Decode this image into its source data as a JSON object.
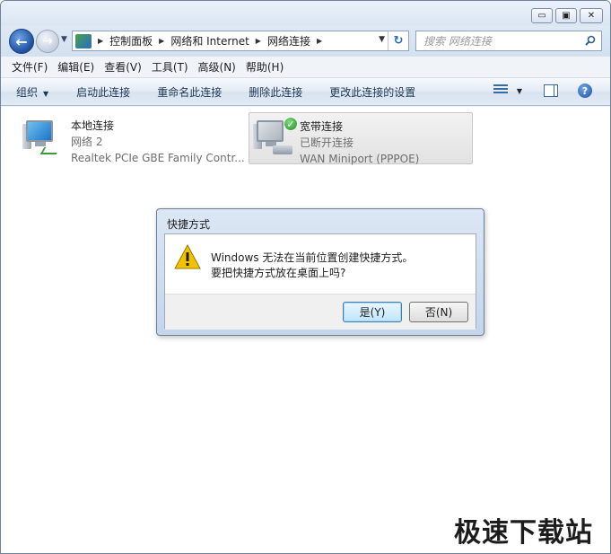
{
  "window": {
    "caption_buttons": {
      "minimize": "▭",
      "maximize": "▣",
      "close": "✕"
    }
  },
  "navigation": {
    "back_glyph": "←",
    "forward_glyph": "→",
    "breadcrumbs": [
      "控制面板",
      "网络和 Internet",
      "网络连接"
    ],
    "search_placeholder": "搜索 网络连接",
    "refresh_glyph": "↻"
  },
  "menubar": {
    "items": [
      "文件(F)",
      "编辑(E)",
      "查看(V)",
      "工具(T)",
      "高级(N)",
      "帮助(H)"
    ]
  },
  "commandbar": {
    "organize": "组织",
    "commands": [
      "启动此连接",
      "重命名此连接",
      "删除此连接",
      "更改此连接的设置"
    ],
    "help_glyph": "?"
  },
  "connections": [
    {
      "name": "本地连接",
      "status": "网络  2",
      "device": "Realtek PCIe GBE Family Contr...",
      "icon": "lan-connection-icon",
      "selected": false
    },
    {
      "name": "宽带连接",
      "status": "已断开连接",
      "device": "WAN Miniport (PPPOE)",
      "icon": "broadband-connection-icon",
      "selected": true,
      "badge_glyph": "✓"
    }
  ],
  "dialog": {
    "title": "快捷方式",
    "line1": "Windows 无法在当前位置创建快捷方式。",
    "line2": "要把快捷方式放在桌面上吗?",
    "yes_label": "是(Y)",
    "no_label": "否(N)",
    "icon": "warning-icon"
  },
  "watermark": "极速下载站",
  "colors": {
    "accent": "#1d4f9e",
    "selected_bg": "#e2e2e2",
    "dialog_frame": "#c5d5ea",
    "check_green": "#1f8e24",
    "warning_yellow": "#f2c200"
  }
}
